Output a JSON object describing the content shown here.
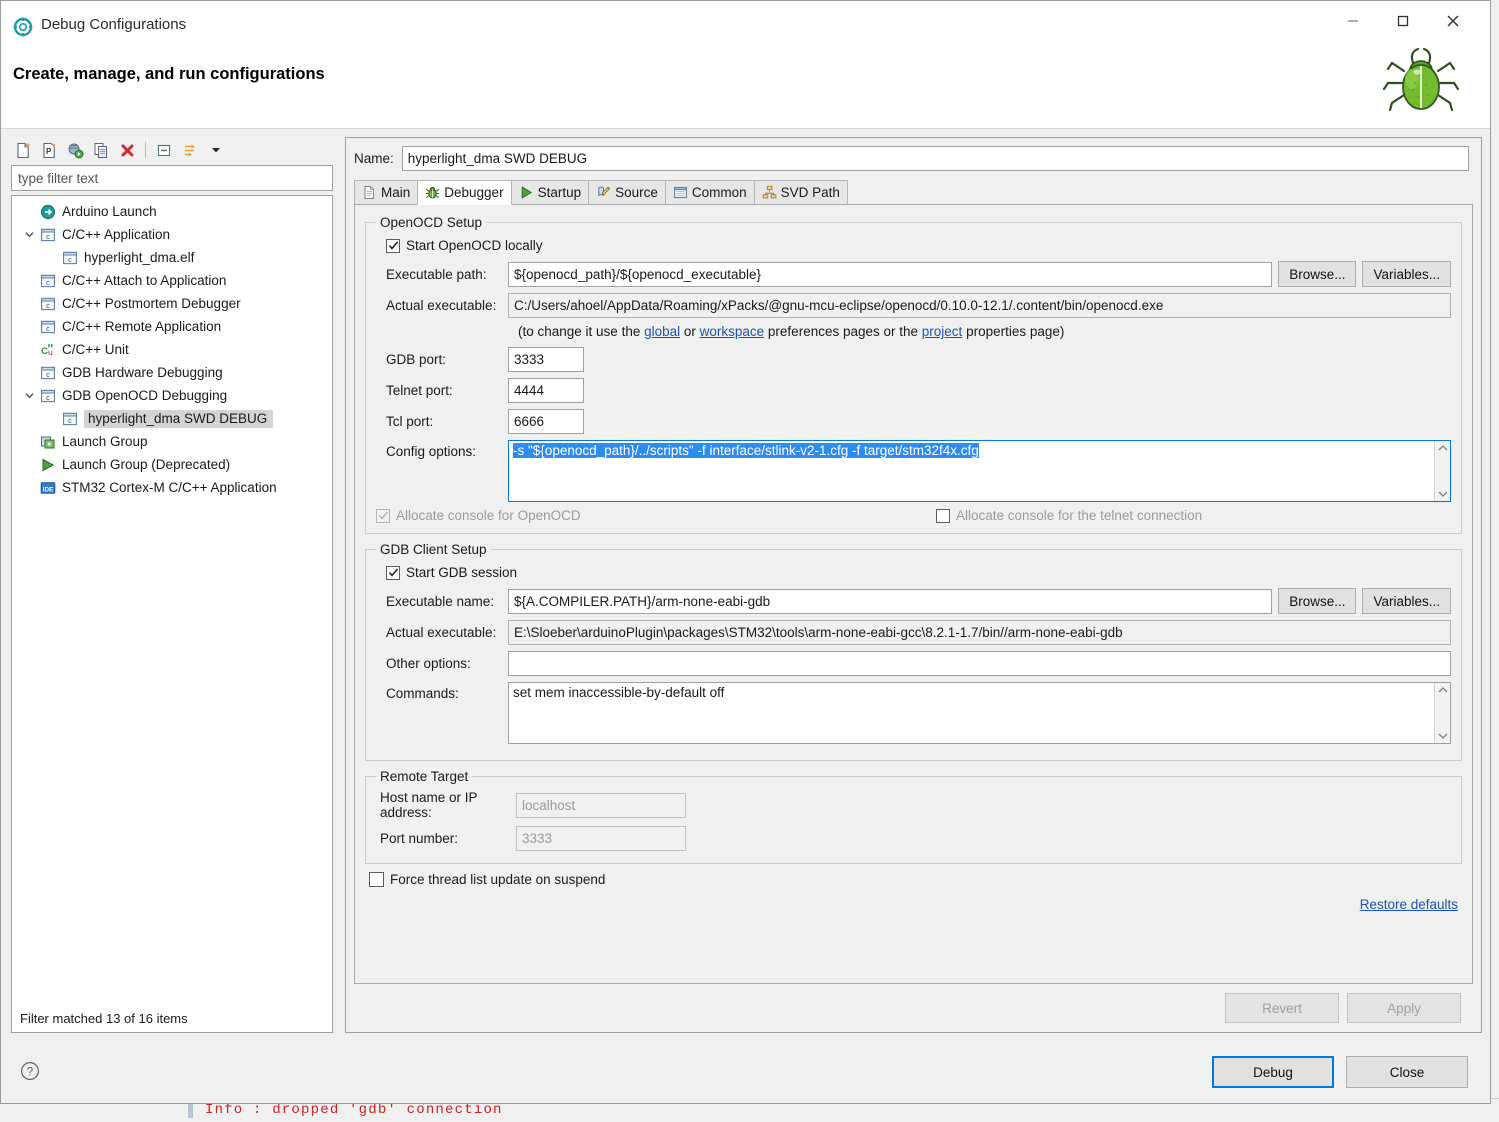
{
  "window": {
    "title": "Debug Configurations",
    "icon": "debug-configurations-icon",
    "minimize_label": "—",
    "maximize_label": "□",
    "close_label": "✕"
  },
  "header": {
    "headline": "Create, manage, and run configurations",
    "decoration_icon": "green-bug-icon"
  },
  "tree_toolbar": {
    "buttons": [
      {
        "name": "new-configuration-icon",
        "label": "New launch configuration"
      },
      {
        "name": "new-prototype-icon",
        "label": "New prototype"
      },
      {
        "name": "export-icon",
        "label": "Export"
      },
      {
        "name": "duplicate-icon",
        "label": "Duplicate"
      },
      {
        "name": "delete-icon",
        "label": "Delete"
      },
      {
        "name": "collapse-all-icon",
        "label": "Collapse All"
      },
      {
        "name": "filter-icon",
        "label": "Filter launch configurations"
      },
      {
        "name": "view-menu-icon",
        "label": "View Menu"
      }
    ]
  },
  "filter": {
    "placeholder": "type filter text",
    "value": "type filter text"
  },
  "tree": {
    "status": "Filter matched 13 of 16 items",
    "items": [
      {
        "label": "Arduino Launch",
        "icon": "arduino-icon",
        "indent": 0,
        "twisty": "",
        "selected": false
      },
      {
        "label": "C/C++ Application",
        "icon": "c-config-icon",
        "indent": 0,
        "twisty": "down",
        "selected": false
      },
      {
        "label": "hyperlight_dma.elf",
        "icon": "c-config-icon",
        "indent": 1,
        "twisty": "",
        "selected": false
      },
      {
        "label": "C/C++ Attach to Application",
        "icon": "c-config-icon",
        "indent": 0,
        "twisty": "",
        "selected": false
      },
      {
        "label": "C/C++ Postmortem Debugger",
        "icon": "c-config-icon",
        "indent": 0,
        "twisty": "",
        "selected": false
      },
      {
        "label": "C/C++ Remote Application",
        "icon": "c-config-icon",
        "indent": 0,
        "twisty": "",
        "selected": false
      },
      {
        "label": "C/C++ Unit",
        "icon": "cunit-icon",
        "indent": 0,
        "twisty": "",
        "selected": false
      },
      {
        "label": "GDB Hardware Debugging",
        "icon": "c-config-icon",
        "indent": 0,
        "twisty": "",
        "selected": false
      },
      {
        "label": "GDB OpenOCD Debugging",
        "icon": "c-config-icon",
        "indent": 0,
        "twisty": "down",
        "selected": false
      },
      {
        "label": "hyperlight_dma SWD DEBUG",
        "icon": "c-config-icon",
        "indent": 1,
        "twisty": "",
        "selected": true
      },
      {
        "label": "Launch Group",
        "icon": "launch-group-icon",
        "indent": 0,
        "twisty": "",
        "selected": false
      },
      {
        "label": "Launch Group (Deprecated)",
        "icon": "launch-group-deprecated-icon",
        "indent": 0,
        "twisty": "",
        "selected": false
      },
      {
        "label": "STM32 Cortex-M C/C++ Application",
        "icon": "stm32-ide-icon",
        "indent": 0,
        "twisty": "",
        "selected": false
      }
    ]
  },
  "name_field": {
    "label": "Name:",
    "value": "hyperlight_dma SWD DEBUG"
  },
  "tabs": [
    {
      "label": "Main",
      "icon": "main-page-icon",
      "active": false
    },
    {
      "label": "Debugger",
      "icon": "debugger-bug-icon",
      "active": true
    },
    {
      "label": "Startup",
      "icon": "startup-play-icon",
      "active": false
    },
    {
      "label": "Source",
      "icon": "source-lookup-icon",
      "active": false
    },
    {
      "label": "Common",
      "icon": "common-window-icon",
      "active": false
    },
    {
      "label": "SVD Path",
      "icon": "svd-tree-icon",
      "active": false
    }
  ],
  "openocd_setup": {
    "legend": "OpenOCD Setup",
    "start_locally": {
      "label": "Start OpenOCD locally",
      "checked": true,
      "enabled": true
    },
    "executable_path": {
      "label": "Executable path:",
      "value": "${openocd_path}/${openocd_executable}",
      "browse": "Browse...",
      "variables": "Variables..."
    },
    "actual_executable": {
      "label": "Actual executable:",
      "value": "C:/Users/ahoel/AppData/Roaming/xPacks/@gnu-mcu-eclipse/openocd/0.10.0-12.1/.content/bin/openocd.exe"
    },
    "hint": {
      "pre": "(to change it use the ",
      "link1": "global",
      "mid1": " or ",
      "link2": "workspace",
      "mid2": " preferences pages or the ",
      "link3": "project",
      "post": " properties page)"
    },
    "gdb_port": {
      "label": "GDB port:",
      "value": "3333"
    },
    "telnet_port": {
      "label": "Telnet port:",
      "value": "4444"
    },
    "tcl_port": {
      "label": "Tcl port:",
      "value": "6666"
    },
    "config_options": {
      "label": "Config options:",
      "value": "-s \"${openocd_path}/../scripts\" -f interface/stlink-v2-1.cfg -f target/stm32f4x.cfg",
      "selected": true
    },
    "allocate_console_openocd": {
      "label": "Allocate console for OpenOCD",
      "checked": true,
      "enabled": false
    },
    "allocate_console_telnet": {
      "label": "Allocate console for the telnet connection",
      "checked": false,
      "enabled": true
    }
  },
  "gdb_client_setup": {
    "legend": "GDB Client Setup",
    "start_gdb_session": {
      "label": "Start GDB session",
      "checked": true,
      "enabled": true
    },
    "executable_name": {
      "label": "Executable name:",
      "value": "${A.COMPILER.PATH}/arm-none-eabi-gdb",
      "browse": "Browse...",
      "variables": "Variables..."
    },
    "actual_executable": {
      "label": "Actual executable:",
      "value": "E:\\Sloeber\\arduinoPlugin\\packages\\STM32\\tools\\arm-none-eabi-gcc\\8.2.1-1.7/bin//arm-none-eabi-gdb"
    },
    "other_options": {
      "label": "Other options:",
      "value": ""
    },
    "commands": {
      "label": "Commands:",
      "value": "set mem inaccessible-by-default off"
    }
  },
  "remote_target": {
    "legend": "Remote Target",
    "host": {
      "label": "Host name or IP address:",
      "placeholder": "localhost",
      "enabled": false
    },
    "port": {
      "label": "Port number:",
      "placeholder": "3333",
      "enabled": false
    }
  },
  "force_thread_update": {
    "label": "Force thread list update on suspend",
    "checked": false
  },
  "restore_defaults": "Restore defaults",
  "action_buttons": {
    "revert": {
      "label": "Revert",
      "enabled": false
    },
    "apply": {
      "label": "Apply",
      "enabled": false
    }
  },
  "footer": {
    "help_icon": "help-question-icon",
    "debug": {
      "label": "Debug",
      "default": true
    },
    "close": {
      "label": "Close",
      "default": false
    }
  },
  "background_console": {
    "text": "Info : dropped 'gdb' connection"
  }
}
